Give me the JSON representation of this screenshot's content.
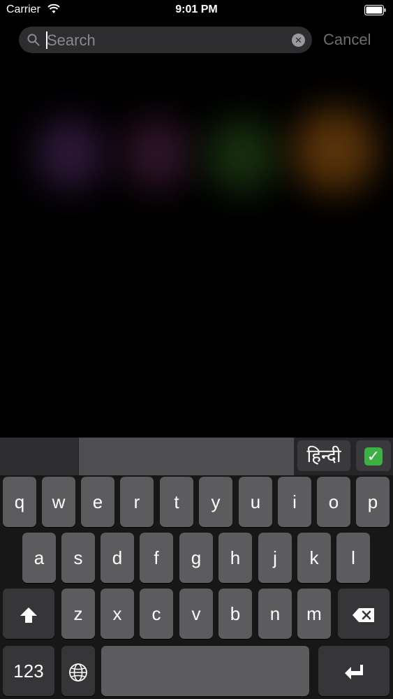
{
  "status_bar": {
    "carrier": "Carrier",
    "time": "9:01 PM"
  },
  "search": {
    "placeholder": "Search",
    "value": "",
    "cancel_label": "Cancel"
  },
  "prediction_bar": {
    "language": "हिन्दी",
    "check_emoji": "✓"
  },
  "keyboard": {
    "row1": [
      "q",
      "w",
      "e",
      "r",
      "t",
      "y",
      "u",
      "i",
      "o",
      "p"
    ],
    "row2": [
      "a",
      "s",
      "d",
      "f",
      "g",
      "h",
      "j",
      "k",
      "l"
    ],
    "row3": [
      "z",
      "x",
      "c",
      "v",
      "b",
      "n",
      "m"
    ],
    "numbers_label": "123",
    "icons": {
      "shift": "shift-icon",
      "delete": "delete-icon",
      "globe": "globe-icon",
      "return": "return-icon"
    }
  },
  "colors": {
    "background": "#000000",
    "key": "#5c5c5e",
    "key_dark": "#363638",
    "accent_green": "#3cb043"
  }
}
